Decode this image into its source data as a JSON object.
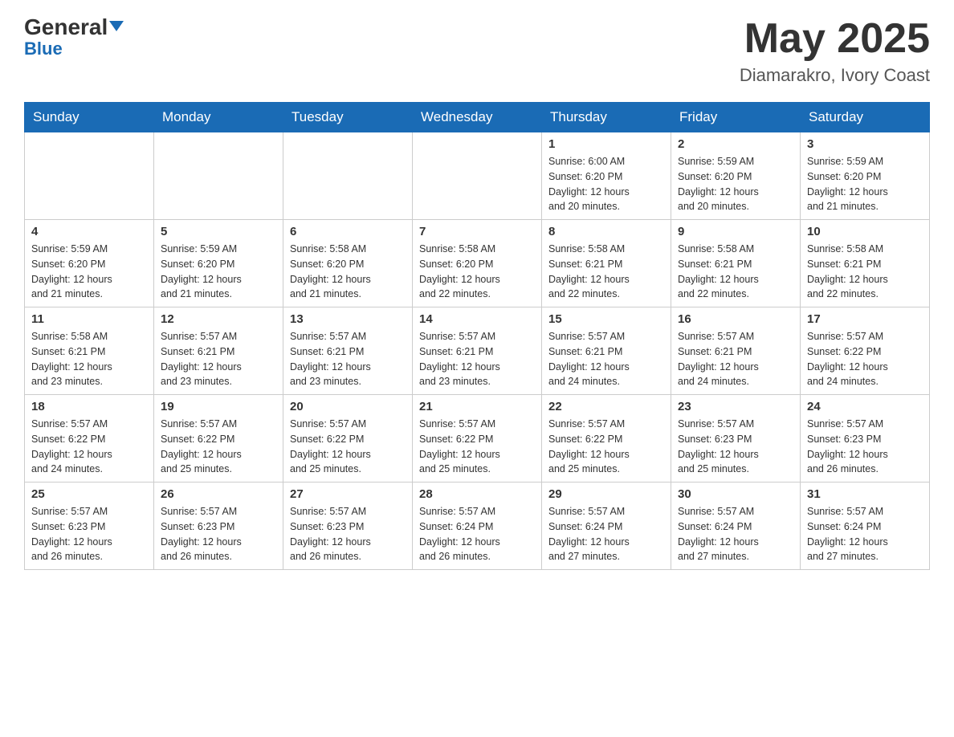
{
  "header": {
    "logo_general": "General",
    "logo_blue": "Blue",
    "month_title": "May 2025",
    "location": "Diamarakro, Ivory Coast"
  },
  "days_of_week": [
    "Sunday",
    "Monday",
    "Tuesday",
    "Wednesday",
    "Thursday",
    "Friday",
    "Saturday"
  ],
  "weeks": [
    {
      "days": [
        {
          "number": "",
          "info": ""
        },
        {
          "number": "",
          "info": ""
        },
        {
          "number": "",
          "info": ""
        },
        {
          "number": "",
          "info": ""
        },
        {
          "number": "1",
          "info": "Sunrise: 6:00 AM\nSunset: 6:20 PM\nDaylight: 12 hours\nand 20 minutes."
        },
        {
          "number": "2",
          "info": "Sunrise: 5:59 AM\nSunset: 6:20 PM\nDaylight: 12 hours\nand 20 minutes."
        },
        {
          "number": "3",
          "info": "Sunrise: 5:59 AM\nSunset: 6:20 PM\nDaylight: 12 hours\nand 21 minutes."
        }
      ]
    },
    {
      "days": [
        {
          "number": "4",
          "info": "Sunrise: 5:59 AM\nSunset: 6:20 PM\nDaylight: 12 hours\nand 21 minutes."
        },
        {
          "number": "5",
          "info": "Sunrise: 5:59 AM\nSunset: 6:20 PM\nDaylight: 12 hours\nand 21 minutes."
        },
        {
          "number": "6",
          "info": "Sunrise: 5:58 AM\nSunset: 6:20 PM\nDaylight: 12 hours\nand 21 minutes."
        },
        {
          "number": "7",
          "info": "Sunrise: 5:58 AM\nSunset: 6:20 PM\nDaylight: 12 hours\nand 22 minutes."
        },
        {
          "number": "8",
          "info": "Sunrise: 5:58 AM\nSunset: 6:21 PM\nDaylight: 12 hours\nand 22 minutes."
        },
        {
          "number": "9",
          "info": "Sunrise: 5:58 AM\nSunset: 6:21 PM\nDaylight: 12 hours\nand 22 minutes."
        },
        {
          "number": "10",
          "info": "Sunrise: 5:58 AM\nSunset: 6:21 PM\nDaylight: 12 hours\nand 22 minutes."
        }
      ]
    },
    {
      "days": [
        {
          "number": "11",
          "info": "Sunrise: 5:58 AM\nSunset: 6:21 PM\nDaylight: 12 hours\nand 23 minutes."
        },
        {
          "number": "12",
          "info": "Sunrise: 5:57 AM\nSunset: 6:21 PM\nDaylight: 12 hours\nand 23 minutes."
        },
        {
          "number": "13",
          "info": "Sunrise: 5:57 AM\nSunset: 6:21 PM\nDaylight: 12 hours\nand 23 minutes."
        },
        {
          "number": "14",
          "info": "Sunrise: 5:57 AM\nSunset: 6:21 PM\nDaylight: 12 hours\nand 23 minutes."
        },
        {
          "number": "15",
          "info": "Sunrise: 5:57 AM\nSunset: 6:21 PM\nDaylight: 12 hours\nand 24 minutes."
        },
        {
          "number": "16",
          "info": "Sunrise: 5:57 AM\nSunset: 6:21 PM\nDaylight: 12 hours\nand 24 minutes."
        },
        {
          "number": "17",
          "info": "Sunrise: 5:57 AM\nSunset: 6:22 PM\nDaylight: 12 hours\nand 24 minutes."
        }
      ]
    },
    {
      "days": [
        {
          "number": "18",
          "info": "Sunrise: 5:57 AM\nSunset: 6:22 PM\nDaylight: 12 hours\nand 24 minutes."
        },
        {
          "number": "19",
          "info": "Sunrise: 5:57 AM\nSunset: 6:22 PM\nDaylight: 12 hours\nand 25 minutes."
        },
        {
          "number": "20",
          "info": "Sunrise: 5:57 AM\nSunset: 6:22 PM\nDaylight: 12 hours\nand 25 minutes."
        },
        {
          "number": "21",
          "info": "Sunrise: 5:57 AM\nSunset: 6:22 PM\nDaylight: 12 hours\nand 25 minutes."
        },
        {
          "number": "22",
          "info": "Sunrise: 5:57 AM\nSunset: 6:22 PM\nDaylight: 12 hours\nand 25 minutes."
        },
        {
          "number": "23",
          "info": "Sunrise: 5:57 AM\nSunset: 6:23 PM\nDaylight: 12 hours\nand 25 minutes."
        },
        {
          "number": "24",
          "info": "Sunrise: 5:57 AM\nSunset: 6:23 PM\nDaylight: 12 hours\nand 26 minutes."
        }
      ]
    },
    {
      "days": [
        {
          "number": "25",
          "info": "Sunrise: 5:57 AM\nSunset: 6:23 PM\nDaylight: 12 hours\nand 26 minutes."
        },
        {
          "number": "26",
          "info": "Sunrise: 5:57 AM\nSunset: 6:23 PM\nDaylight: 12 hours\nand 26 minutes."
        },
        {
          "number": "27",
          "info": "Sunrise: 5:57 AM\nSunset: 6:23 PM\nDaylight: 12 hours\nand 26 minutes."
        },
        {
          "number": "28",
          "info": "Sunrise: 5:57 AM\nSunset: 6:24 PM\nDaylight: 12 hours\nand 26 minutes."
        },
        {
          "number": "29",
          "info": "Sunrise: 5:57 AM\nSunset: 6:24 PM\nDaylight: 12 hours\nand 27 minutes."
        },
        {
          "number": "30",
          "info": "Sunrise: 5:57 AM\nSunset: 6:24 PM\nDaylight: 12 hours\nand 27 minutes."
        },
        {
          "number": "31",
          "info": "Sunrise: 5:57 AM\nSunset: 6:24 PM\nDaylight: 12 hours\nand 27 minutes."
        }
      ]
    }
  ]
}
